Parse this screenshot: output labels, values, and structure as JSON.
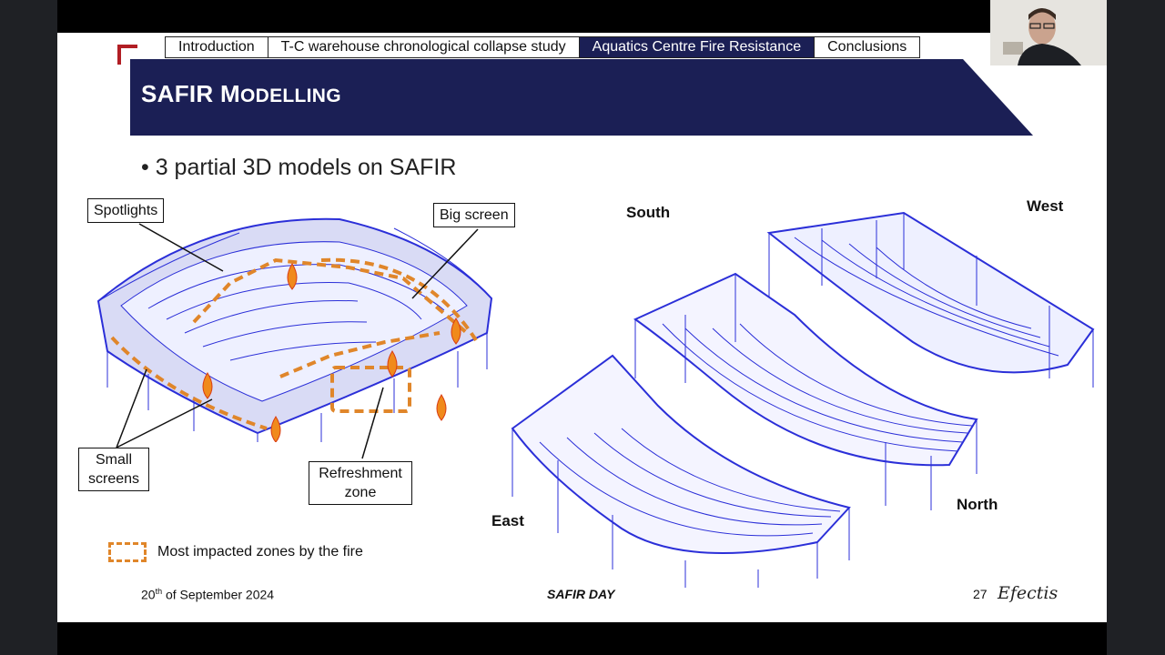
{
  "nav": {
    "tabs": [
      {
        "label": "Introduction",
        "active": false
      },
      {
        "label": "T-C warehouse chronological collapse study",
        "active": false
      },
      {
        "label": "Aquatics Centre Fire Resistance",
        "active": true
      },
      {
        "label": "Conclusions",
        "active": false
      }
    ]
  },
  "header": {
    "title_first": "SAFIR M",
    "title_rest": "ODELLING"
  },
  "bullet": "• 3 partial 3D models on SAFIR",
  "left_model": {
    "callouts": {
      "spotlights": "Spotlights",
      "big_screen": "Big screen",
      "small_screens_1": "Small",
      "small_screens_2": "screens",
      "refreshment_1": "Refreshment",
      "refreshment_2": "zone"
    }
  },
  "right_model": {
    "labels": {
      "south": "South",
      "west": "West",
      "east": "East",
      "north": "North"
    }
  },
  "legend": {
    "label": "Most impacted zones by the fire"
  },
  "footer": {
    "date_day": "20",
    "date_sup": "th",
    "date_rest": " of September 2024",
    "event": "SAFIR DAY",
    "page": "27",
    "logo_text": "Efectis"
  },
  "colors": {
    "banner": "#1b1f55",
    "accent_red": "#b11e24",
    "structure": "#2b2fd8",
    "fire_zone": "#e0862a"
  }
}
